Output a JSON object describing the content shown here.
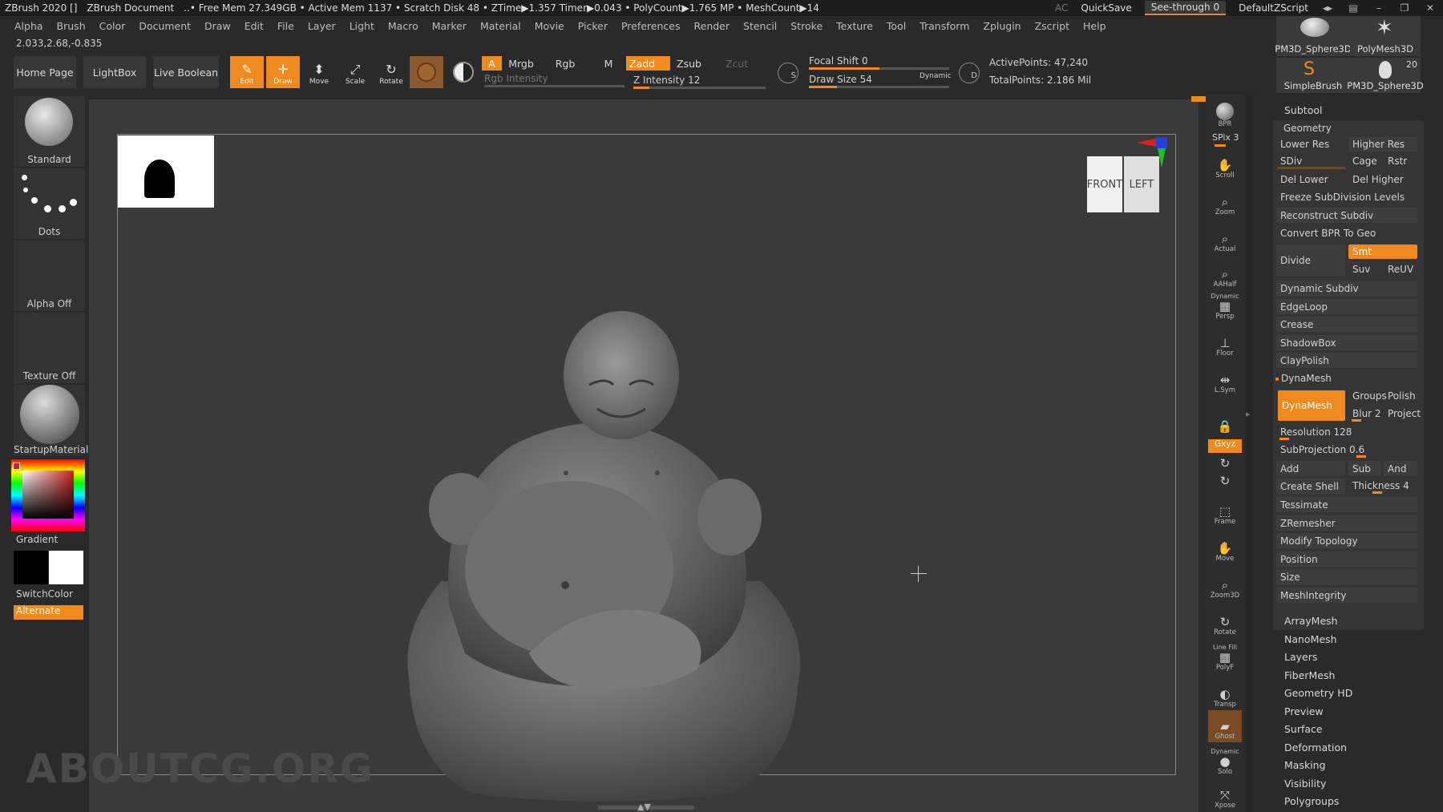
{
  "titlebar": {
    "app": "ZBrush 2020 []",
    "document": "ZBrush Document",
    "stats": "..• Free Mem 27.349GB • Active Mem 1137 • Scratch Disk 48 • ZTime▶1.357 Timer▶0.043 • PolyCount▶1.765 MP • MeshCount▶14",
    "ac": "AC",
    "quicksave": "QuickSave",
    "seethrough": "See-through",
    "seethrough_value": "0",
    "script": "DefaultZScript"
  },
  "menu": [
    "Alpha",
    "Brush",
    "Color",
    "Document",
    "Draw",
    "Edit",
    "File",
    "Layer",
    "Light",
    "Macro",
    "Marker",
    "Material",
    "Movie",
    "Picker",
    "Preferences",
    "Render",
    "Stencil",
    "Stroke",
    "Texture",
    "Tool",
    "Transform",
    "Zplugin",
    "Zscript",
    "Help"
  ],
  "coords": "2.033,2.68,-0.835",
  "toolbar": {
    "home": "Home Page",
    "lightbox": "LightBox",
    "liveboolean": "Live Boolean",
    "edit": "Edit",
    "draw": "Draw",
    "move": "Move",
    "scale": "Scale",
    "rotate": "Rotate",
    "a": "A",
    "mrgb": "Mrgb",
    "rgb": "Rgb",
    "m": "M",
    "zadd": "Zadd",
    "zsub": "Zsub",
    "zcut": "Zcut",
    "rgb_intensity": "Rgb Intensity",
    "z_intensity": "Z Intensity 12",
    "focal_shift": "Focal Shift 0",
    "draw_size": "Draw Size 54",
    "dynamic": "Dynamic",
    "active_points": "ActivePoints: 47,240",
    "total_points": "TotalPoints: 2.186 Mil",
    "z_intensity_level": 0.12,
    "focal_shift_level": 0.5,
    "draw_size_level": 0.2
  },
  "leftshelf": {
    "brush": "Standard",
    "stroke": "Dots",
    "alpha": "Alpha Off",
    "texture": "Texture Off",
    "material": "StartupMaterial",
    "gradient": "Gradient",
    "switchcolor": "SwitchColor",
    "alternate": "Alternate"
  },
  "navcube": {
    "front": "FRONT",
    "left": "LEFT"
  },
  "navbar": {
    "bpr": "BPR",
    "spix": "SPix 3",
    "scroll": "Scroll",
    "zoom": "Zoom",
    "actual": "Actual",
    "aahalf": "AAHalf",
    "dynamic": "Dynamic",
    "persp": "Persp",
    "floor": "Floor",
    "lsym": "L.Sym",
    "xyz": "Gxyz",
    "frame": "Frame",
    "move": "Move",
    "zoom3d": "Zoom3D",
    "rotate": "Rotate",
    "linefill": "Line Fill",
    "polyf": "PolyF",
    "transp": "Transp",
    "ghost": "Ghost",
    "dynamic2": "Dynamic",
    "solo": "Solo",
    "xpose": "Xpose"
  },
  "subtools_top": {
    "t1": "PM3D_Sphere3D",
    "t2": "PolyMesh3D",
    "t3": "SimpleBrush",
    "t4": "PM3D_Sphere3D",
    "count": "20"
  },
  "panel": {
    "subtool": "Subtool",
    "geometry": "Geometry",
    "lower_res": "Lower Res",
    "higher_res": "Higher Res",
    "sdiv": "SDiv",
    "cage": "Cage",
    "rstr": "Rstr",
    "del_lower": "Del Lower",
    "del_higher": "Del Higher",
    "freeze": "Freeze SubDivision Levels",
    "reconstruct": "Reconstruct Subdiv",
    "convert_bpr": "Convert BPR To Geo",
    "divide": "Divide",
    "smt": "Smt",
    "suv": "Suv",
    "reuv": "ReUV",
    "dynamic_subdiv": "Dynamic Subdiv",
    "edgeloop": "EdgeLoop",
    "crease": "Crease",
    "shadowbox": "ShadowBox",
    "claypolish": "ClayPolish",
    "dynamesh_header": "DynaMesh",
    "dynamesh_btn": "DynaMesh",
    "groups": "Groups",
    "polish": "Polish",
    "blur": "Blur 2",
    "project": "Project",
    "resolution": "Resolution 128",
    "subprojection": "SubProjection 0.6",
    "add": "Add",
    "sub": "Sub",
    "and": "And",
    "create_shell": "Create Shell",
    "thickness": "Thickness 4",
    "tessimate": "Tessimate",
    "zremesher": "ZRemesher",
    "modify_topology": "Modify Topology",
    "position": "Position",
    "size": "Size",
    "meshintegrity": "MeshIntegrity"
  },
  "sections": [
    "ArrayMesh",
    "NanoMesh",
    "Layers",
    "FiberMesh",
    "Geometry HD",
    "Preview",
    "Surface",
    "Deformation",
    "Masking",
    "Visibility",
    "Polygroups"
  ],
  "watermark": "ABOUTCG.ORG",
  "colors": {
    "accent": "#f08a1e",
    "panel": "#353535",
    "viewport": "#3a3a3a"
  }
}
